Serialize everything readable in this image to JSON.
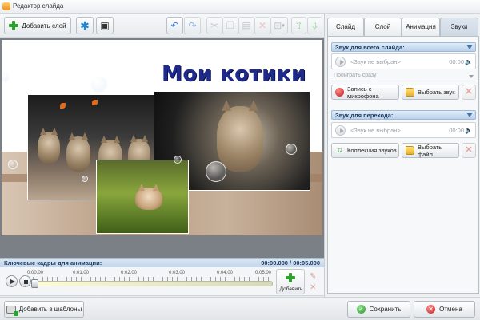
{
  "window": {
    "title": "Редактор слайда"
  },
  "toolbar": {
    "add_layer_label": "Добавить слой",
    "effects_icon": "snowflake-icon",
    "layers_icon": "monitor-icon",
    "undo_icon": "undo-icon",
    "redo_icon": "redo-icon",
    "cut_icon": "scissors-icon",
    "copy_icon": "copy-icon",
    "paste_icon": "paste-icon",
    "delete_icon": "delete-icon",
    "align_icon": "align-icon",
    "move_up_icon": "arrow-up-icon",
    "move_down_icon": "arrow-down-icon"
  },
  "slide": {
    "title_text": "Мои котики"
  },
  "keyframes": {
    "label": "Ключевые кадры для анимации:",
    "time": "00:00.000 / 00:05.000",
    "ticks": [
      "0:00.00",
      "0:01.00",
      "0:02.00",
      "0:03.00",
      "0:04.00",
      "0:05.00"
    ],
    "add_label": "Добавить"
  },
  "panel": {
    "tabs": [
      {
        "label": "Слайд",
        "active": false
      },
      {
        "label": "Слой",
        "active": false
      },
      {
        "label": "Анимация",
        "active": false
      },
      {
        "label": "Звуки",
        "active": true
      }
    ],
    "slide_sound": {
      "header": "Звук для всего слайда:",
      "name": "<Звук не выбран>",
      "duration": "00:00",
      "play_mode": "Проиграть сразу",
      "record_label": "Запись с микрофона",
      "choose_label": "Выбрать звук"
    },
    "transition_sound": {
      "header": "Звук для перехода:",
      "name": "<Звук не выбран>",
      "duration": "00:00",
      "collection_label": "Коллекция звуков",
      "choose_file_label": "Выбрать файл"
    }
  },
  "bottom": {
    "add_template_label": "Добавить в шаблоны",
    "save_label": "Сохранить",
    "cancel_label": "Отмена"
  },
  "colors": {
    "title_text": "#1e2a8c",
    "accent_header": "#b9d1ec",
    "ok_green": "#2b9b2b",
    "cancel_red": "#c71e1e"
  }
}
